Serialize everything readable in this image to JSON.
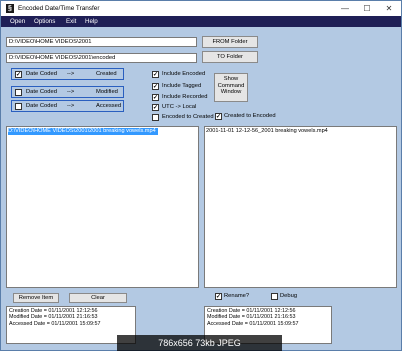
{
  "window": {
    "title": "Encoded Date/Time Transfer",
    "icon_glyph": "§",
    "minimize": "—",
    "maximize": "☐",
    "close": "✕"
  },
  "menu": [
    "Open",
    "Options",
    "Exit",
    "Help"
  ],
  "paths": {
    "from_value": "D:\\VIDEO\\HOME VIDEOS\\2001",
    "from_button": "FROM Folder",
    "to_value": "D:\\VIDEO\\HOME VIDEOS\\2001\\encoded",
    "to_button": "TO Folder"
  },
  "mappings": [
    {
      "checked": true,
      "source": "Date Coded",
      "arrow": "-->",
      "target": "Created"
    },
    {
      "checked": false,
      "source": "Date Coded",
      "arrow": "-->",
      "target": "Modified"
    },
    {
      "checked": false,
      "source": "Date Coded",
      "arrow": "-->",
      "target": "Accessed"
    }
  ],
  "options": [
    {
      "checked": true,
      "label": "Include Encoded"
    },
    {
      "checked": true,
      "label": "Include Tagged"
    },
    {
      "checked": true,
      "label": "Include Recorded"
    },
    {
      "checked": true,
      "label": "UTC -> Local"
    },
    {
      "checked": false,
      "label": "Encoded to Created"
    }
  ],
  "created_to_encoded": {
    "checked": true,
    "label": "Created to Encoded"
  },
  "show_command_button": [
    "Show",
    "Command",
    "Window"
  ],
  "source_list": {
    "selected_item": "D:\\VIDEO\\HOME VIDEOS\\2001\\2001 breaking vowels.mp4"
  },
  "target_list": {
    "items": [
      "2001-11-01 12-12-56_2001 breaking vowels.mp4"
    ]
  },
  "buttons": {
    "remove": "Remove Item",
    "clear": "Clear"
  },
  "rename": {
    "checked": true,
    "label": "Rename?"
  },
  "debug": {
    "checked": false,
    "label": "Debug"
  },
  "source_info": [
    "Creation Date = 01/11/2001 12:12:56",
    "Modified Date = 01/11/2001 21:16:53",
    "Accessed Date = 01/11/2001 15:09:57"
  ],
  "target_info": [
    "Creation Date = 01/11/2001 12:12:56",
    "Modified Date = 01/11/2001 21:16:53",
    "Accessed Date = 01/11/2001 15:09:57"
  ],
  "image_caption": "786x656  73kb  JPEG",
  "colors": {
    "window_bg": "#b3c9e3",
    "menubar": "#1f1f56",
    "selection": "#3399ff",
    "border_accent": "#2a5fbf"
  }
}
